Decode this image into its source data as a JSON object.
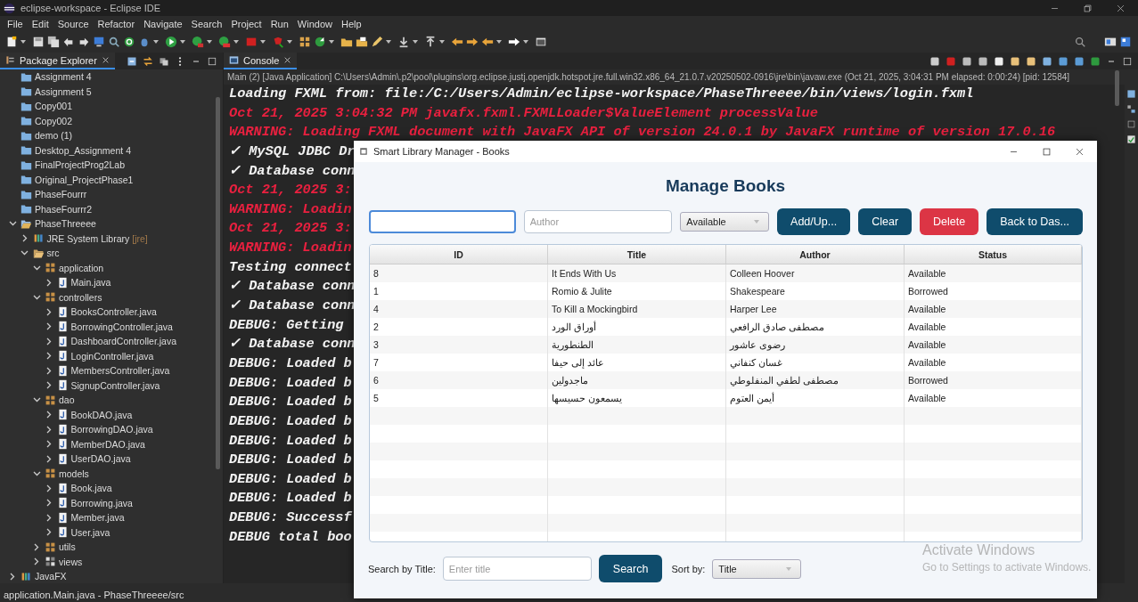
{
  "window": {
    "title": "eclipse-workspace - Eclipse IDE"
  },
  "menu": [
    "File",
    "Edit",
    "Source",
    "Refactor",
    "Navigate",
    "Search",
    "Project",
    "Run",
    "Window",
    "Help"
  ],
  "package_explorer": {
    "tab": "Package Explorer",
    "tree": [
      {
        "label": "Assignment 4",
        "kind": "project"
      },
      {
        "label": "Assignment 5",
        "kind": "project"
      },
      {
        "label": "Copy001",
        "kind": "project"
      },
      {
        "label": "Copy002",
        "kind": "project"
      },
      {
        "label": "demo (1)",
        "kind": "project"
      },
      {
        "label": "Desktop_Assignment 4",
        "kind": "project"
      },
      {
        "label": "FinalProjectProg2Lab",
        "kind": "project"
      },
      {
        "label": "Original_ProjectPhase1",
        "kind": "project"
      },
      {
        "label": "PhaseFourrr",
        "kind": "project"
      },
      {
        "label": "PhaseFourrr2",
        "kind": "project"
      },
      {
        "label": "PhaseThreeee",
        "kind": "open-project",
        "expanded": true,
        "children": [
          {
            "label": "JRE System Library",
            "decoration": "[jre]",
            "kind": "library",
            "expanded": false
          },
          {
            "label": "src",
            "kind": "folder",
            "expanded": true,
            "children": [
              {
                "label": "application",
                "kind": "package",
                "expanded": true,
                "children": [
                  {
                    "label": "Main.java",
                    "kind": "file",
                    "expanded": false
                  }
                ]
              },
              {
                "label": "controllers",
                "kind": "package",
                "expanded": true,
                "children": [
                  {
                    "label": "BooksController.java",
                    "kind": "file",
                    "expanded": false
                  },
                  {
                    "label": "BorrowingController.java",
                    "kind": "file",
                    "expanded": false
                  },
                  {
                    "label": "DashboardController.java",
                    "kind": "file",
                    "expanded": false
                  },
                  {
                    "label": "LoginController.java",
                    "kind": "file",
                    "expanded": false
                  },
                  {
                    "label": "MembersController.java",
                    "kind": "file",
                    "expanded": false
                  },
                  {
                    "label": "SignupController.java",
                    "kind": "file",
                    "expanded": false
                  }
                ]
              },
              {
                "label": "dao",
                "kind": "package",
                "expanded": true,
                "children": [
                  {
                    "label": "BookDAO.java",
                    "kind": "file",
                    "expanded": false
                  },
                  {
                    "label": "BorrowingDAO.java",
                    "kind": "file",
                    "expanded": false
                  },
                  {
                    "label": "MemberDAO.java",
                    "kind": "file",
                    "expanded": false
                  },
                  {
                    "label": "UserDAO.java",
                    "kind": "file",
                    "expanded": false
                  }
                ]
              },
              {
                "label": "models",
                "kind": "package",
                "expanded": true,
                "children": [
                  {
                    "label": "Book.java",
                    "kind": "file",
                    "expanded": false
                  },
                  {
                    "label": "Borrowing.java",
                    "kind": "file",
                    "expanded": false
                  },
                  {
                    "label": "Member.java",
                    "kind": "file",
                    "expanded": false
                  },
                  {
                    "label": "User.java",
                    "kind": "file",
                    "expanded": false
                  }
                ]
              },
              {
                "label": "utils",
                "kind": "package",
                "expanded": false
              },
              {
                "label": "views",
                "kind": "views",
                "expanded": false
              }
            ]
          }
        ]
      },
      {
        "label": "JavaFX",
        "kind": "library",
        "expanded": false
      }
    ]
  },
  "console": {
    "tab": "Console",
    "process": "Main (2) [Java Application] C:\\Users\\Admin\\.p2\\pool\\plugins\\org.eclipse.justj.openjdk.hotspot.jre.full.win32.x86_64_21.0.7.v20250502-0916\\jre\\bin\\javaw.exe  (Oct 21, 2025, 3:04:31 PM elapsed: 0:00:24) [pid: 12584]",
    "lines": [
      {
        "kind": "out",
        "text": "Loading FXML from: file:/C:/Users/Admin/eclipse-workspace/PhaseThreeee/bin/views/login.fxml"
      },
      {
        "kind": "err",
        "text": "Oct 21, 2025 3:04:32 PM javafx.fxml.FXMLLoader$ValueElement processValue"
      },
      {
        "kind": "err",
        "text": "WARNING: Loading FXML document with JavaFX API of version 24.0.1 by JavaFX runtime of version 17.0.16"
      },
      {
        "kind": "out",
        "text": "✓ MySQL JDBC Dr"
      },
      {
        "kind": "out",
        "text": "✓ Database conn"
      },
      {
        "kind": "err",
        "text": "Oct 21, 2025 3:"
      },
      {
        "kind": "err",
        "text": "WARNING: Loadin"
      },
      {
        "kind": "err",
        "text": "Oct 21, 2025 3:"
      },
      {
        "kind": "err",
        "text": "WARNING: Loadin"
      },
      {
        "kind": "out",
        "text": "Testing connect"
      },
      {
        "kind": "out",
        "text": "✓ Database conn"
      },
      {
        "kind": "out",
        "text": "✓ Database conn"
      },
      {
        "kind": "out",
        "text": "DEBUG: Getting"
      },
      {
        "kind": "out",
        "text": "✓ Database conn"
      },
      {
        "kind": "out",
        "text": "DEBUG: Loaded b"
      },
      {
        "kind": "out",
        "text": "DEBUG: Loaded b"
      },
      {
        "kind": "out",
        "text": "DEBUG: Loaded b"
      },
      {
        "kind": "out",
        "text": "DEBUG: Loaded b"
      },
      {
        "kind": "out",
        "text": "DEBUG: Loaded b"
      },
      {
        "kind": "out",
        "text": "DEBUG: Loaded b"
      },
      {
        "kind": "out",
        "text": "DEBUG: Loaded b"
      },
      {
        "kind": "out",
        "text": "DEBUG: Loaded b"
      },
      {
        "kind": "out",
        "text": "DEBUG: Successf"
      },
      {
        "kind": "out",
        "text": "DEBUG total boo"
      }
    ]
  },
  "status_bar": "application.Main.java - PhaseThreeee/src",
  "dialog": {
    "title": "Smart Library Manager - Books",
    "heading": "Manage Books",
    "title_field": {
      "focused": true
    },
    "author_field": {
      "placeholder": "Author",
      "focused": false
    },
    "status_select": {
      "value": "Available"
    },
    "buttons": [
      {
        "label": "Add/Up...",
        "kind": "primary"
      },
      {
        "label": "Clear",
        "kind": "primary"
      },
      {
        "label": "Delete",
        "kind": "danger"
      },
      {
        "label": "Back to Das...",
        "kind": "primary"
      }
    ],
    "table": {
      "columns": [
        "ID",
        "Title",
        "Author",
        "Status"
      ],
      "rows": [
        [
          "8",
          "It Ends With Us",
          "Colleen Hoover",
          "Available"
        ],
        [
          "1",
          "Romio & Julite",
          "Shakespeare",
          "Borrowed"
        ],
        [
          "4",
          "To Kill a Mockingbird",
          "Harper Lee",
          "Available"
        ],
        [
          "2",
          "أوراق الورد",
          "مصطفى صادق الرافعي",
          "Available"
        ],
        [
          "3",
          "الطنطورية",
          "رضوى عاشور",
          "Available"
        ],
        [
          "7",
          "عائد إلى حيفا",
          "غسان كنفاني",
          "Available"
        ],
        [
          "6",
          "ماجدولين",
          "مصطفى لطفي المنفلوطي",
          "Borrowed"
        ],
        [
          "5",
          "يسمعون حسيسها",
          "أيمن العتوم",
          "Available"
        ]
      ]
    },
    "search_label": "Search by Title:",
    "search_field": {
      "placeholder": "Enter title"
    },
    "search_button": "Search",
    "sort_label": "Sort by:",
    "sort_select": {
      "value": "Title"
    }
  },
  "os_notice": {
    "title": "Activate Windows",
    "text": "Go to Settings to activate Windows."
  }
}
